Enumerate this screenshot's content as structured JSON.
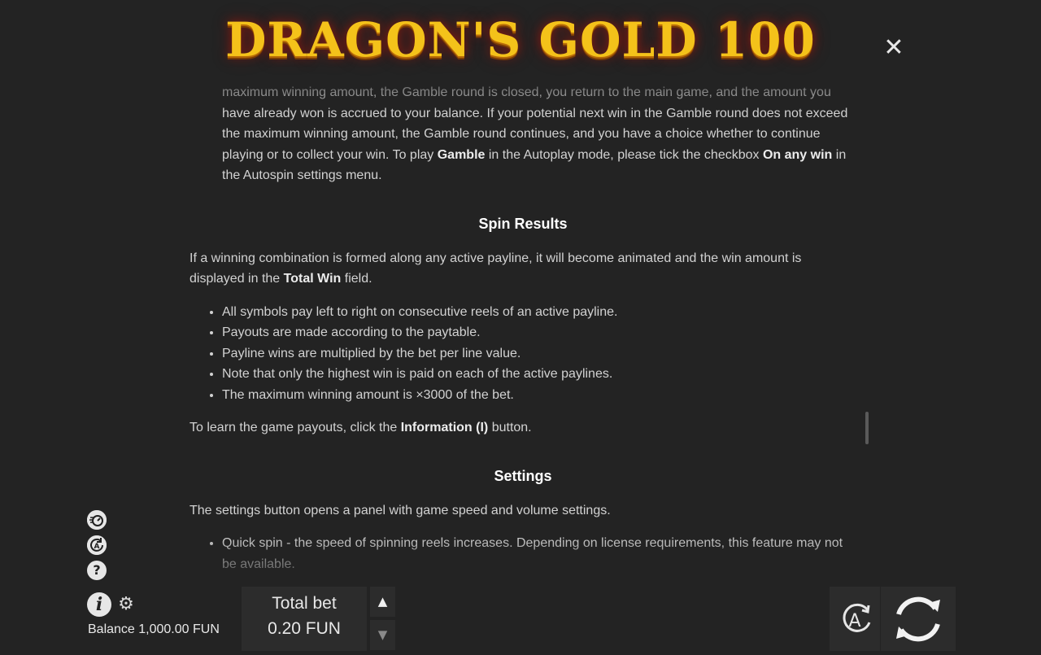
{
  "header": {
    "logo_text": "DRAGON'S GOLD 100",
    "close_glyph": "✕"
  },
  "rules": {
    "intro_lines": [
      "maximum winning amount, the Gamble round is closed, you return to the main game, and the amount you",
      "have already won is accrued to your balance. If your potential next win in the Gamble round does not exceed",
      "the maximum winning amount, the Gamble round continues, and you have a choice whether to continue"
    ],
    "intro_last": {
      "t1": "playing or to collect your win. To play ",
      "b1": "Gamble",
      "t2": " in the Autoplay mode, please tick the checkbox ",
      "b2": "On any win",
      "t3": " in",
      "t4": "the Autospin settings menu."
    },
    "spin_results": {
      "title": "Spin Results",
      "para_t1": "If a winning combination is formed along any active payline, it will become animated and the win amount is",
      "para_t2": "displayed in the ",
      "para_b": "Total Win",
      "para_t3": " field.",
      "bullets": [
        "All symbols pay left to right on consecutive reels of an active payline.",
        "Payouts are made according to the paytable.",
        "Payline wins are multiplied by the bet per line value.",
        "Note that only the highest win is paid on each of the active paylines.",
        "The maximum winning amount is ×3000 of the bet."
      ],
      "learn_t1": "To learn the game payouts, click the ",
      "learn_b": "Information (I)",
      "learn_t2": " button."
    },
    "settings": {
      "title": "Settings",
      "para": "The settings button opens a panel with game speed and volume settings.",
      "bullet_1": "Quick spin - the speed of spinning reels increases. Depending on license requirements, this feature may not",
      "bullet_1_cont": "be available."
    }
  },
  "sidebar": {
    "icons": [
      "quick-spin-icon",
      "autoplay-settings-icon",
      "help-icon",
      "info-icon",
      "gear-icon"
    ],
    "help_glyph": "?",
    "info_glyph": "i",
    "gear_glyph": "⚙"
  },
  "balance": {
    "text": "Balance 1,000.00 FUN"
  },
  "bet": {
    "title": "Total bet",
    "value": "0.20 FUN",
    "up_glyph": "▲",
    "down_glyph": "▼"
  },
  "controls": {
    "autoplay_label": "A"
  },
  "colors": {
    "background": "#232323",
    "panel": "#2c2c2c",
    "logo_gold": "#f4c21a",
    "text": "#d2d2d2"
  }
}
